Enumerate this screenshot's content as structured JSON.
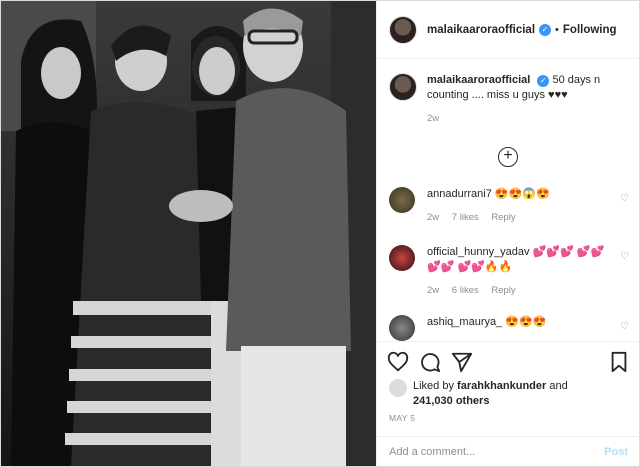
{
  "header": {
    "username": "malaikaaroraofficial",
    "separator": "•",
    "follow_status": "Following"
  },
  "caption": {
    "username": "malaikaaroraofficial",
    "text": "50 days n counting .... miss u guys ♥♥♥",
    "time": "2w"
  },
  "load_more_icon": "plus-circle-icon",
  "comments": [
    {
      "username": "annadurrani7",
      "text": "😍😍😱😍",
      "time": "2w",
      "likes": "7 likes",
      "reply": "Reply"
    },
    {
      "username": "official_hunny_yadav",
      "text": "💕💕💕 💕💕 💕💕 💕💕🔥🔥",
      "time": "2w",
      "likes": "6 likes",
      "reply": "Reply"
    },
    {
      "username": "ashiq_maurya_",
      "text": "😍😍😍"
    }
  ],
  "likes": {
    "prefix": "Liked by",
    "user": "farahkhankunder",
    "and": "and",
    "count": "241,030 others"
  },
  "date": "MAY 5",
  "add_comment": {
    "placeholder": "Add a comment...",
    "post_label": "Post"
  },
  "colors": {
    "verified": "#3897f0",
    "post_disabled": "#b2dffc"
  }
}
